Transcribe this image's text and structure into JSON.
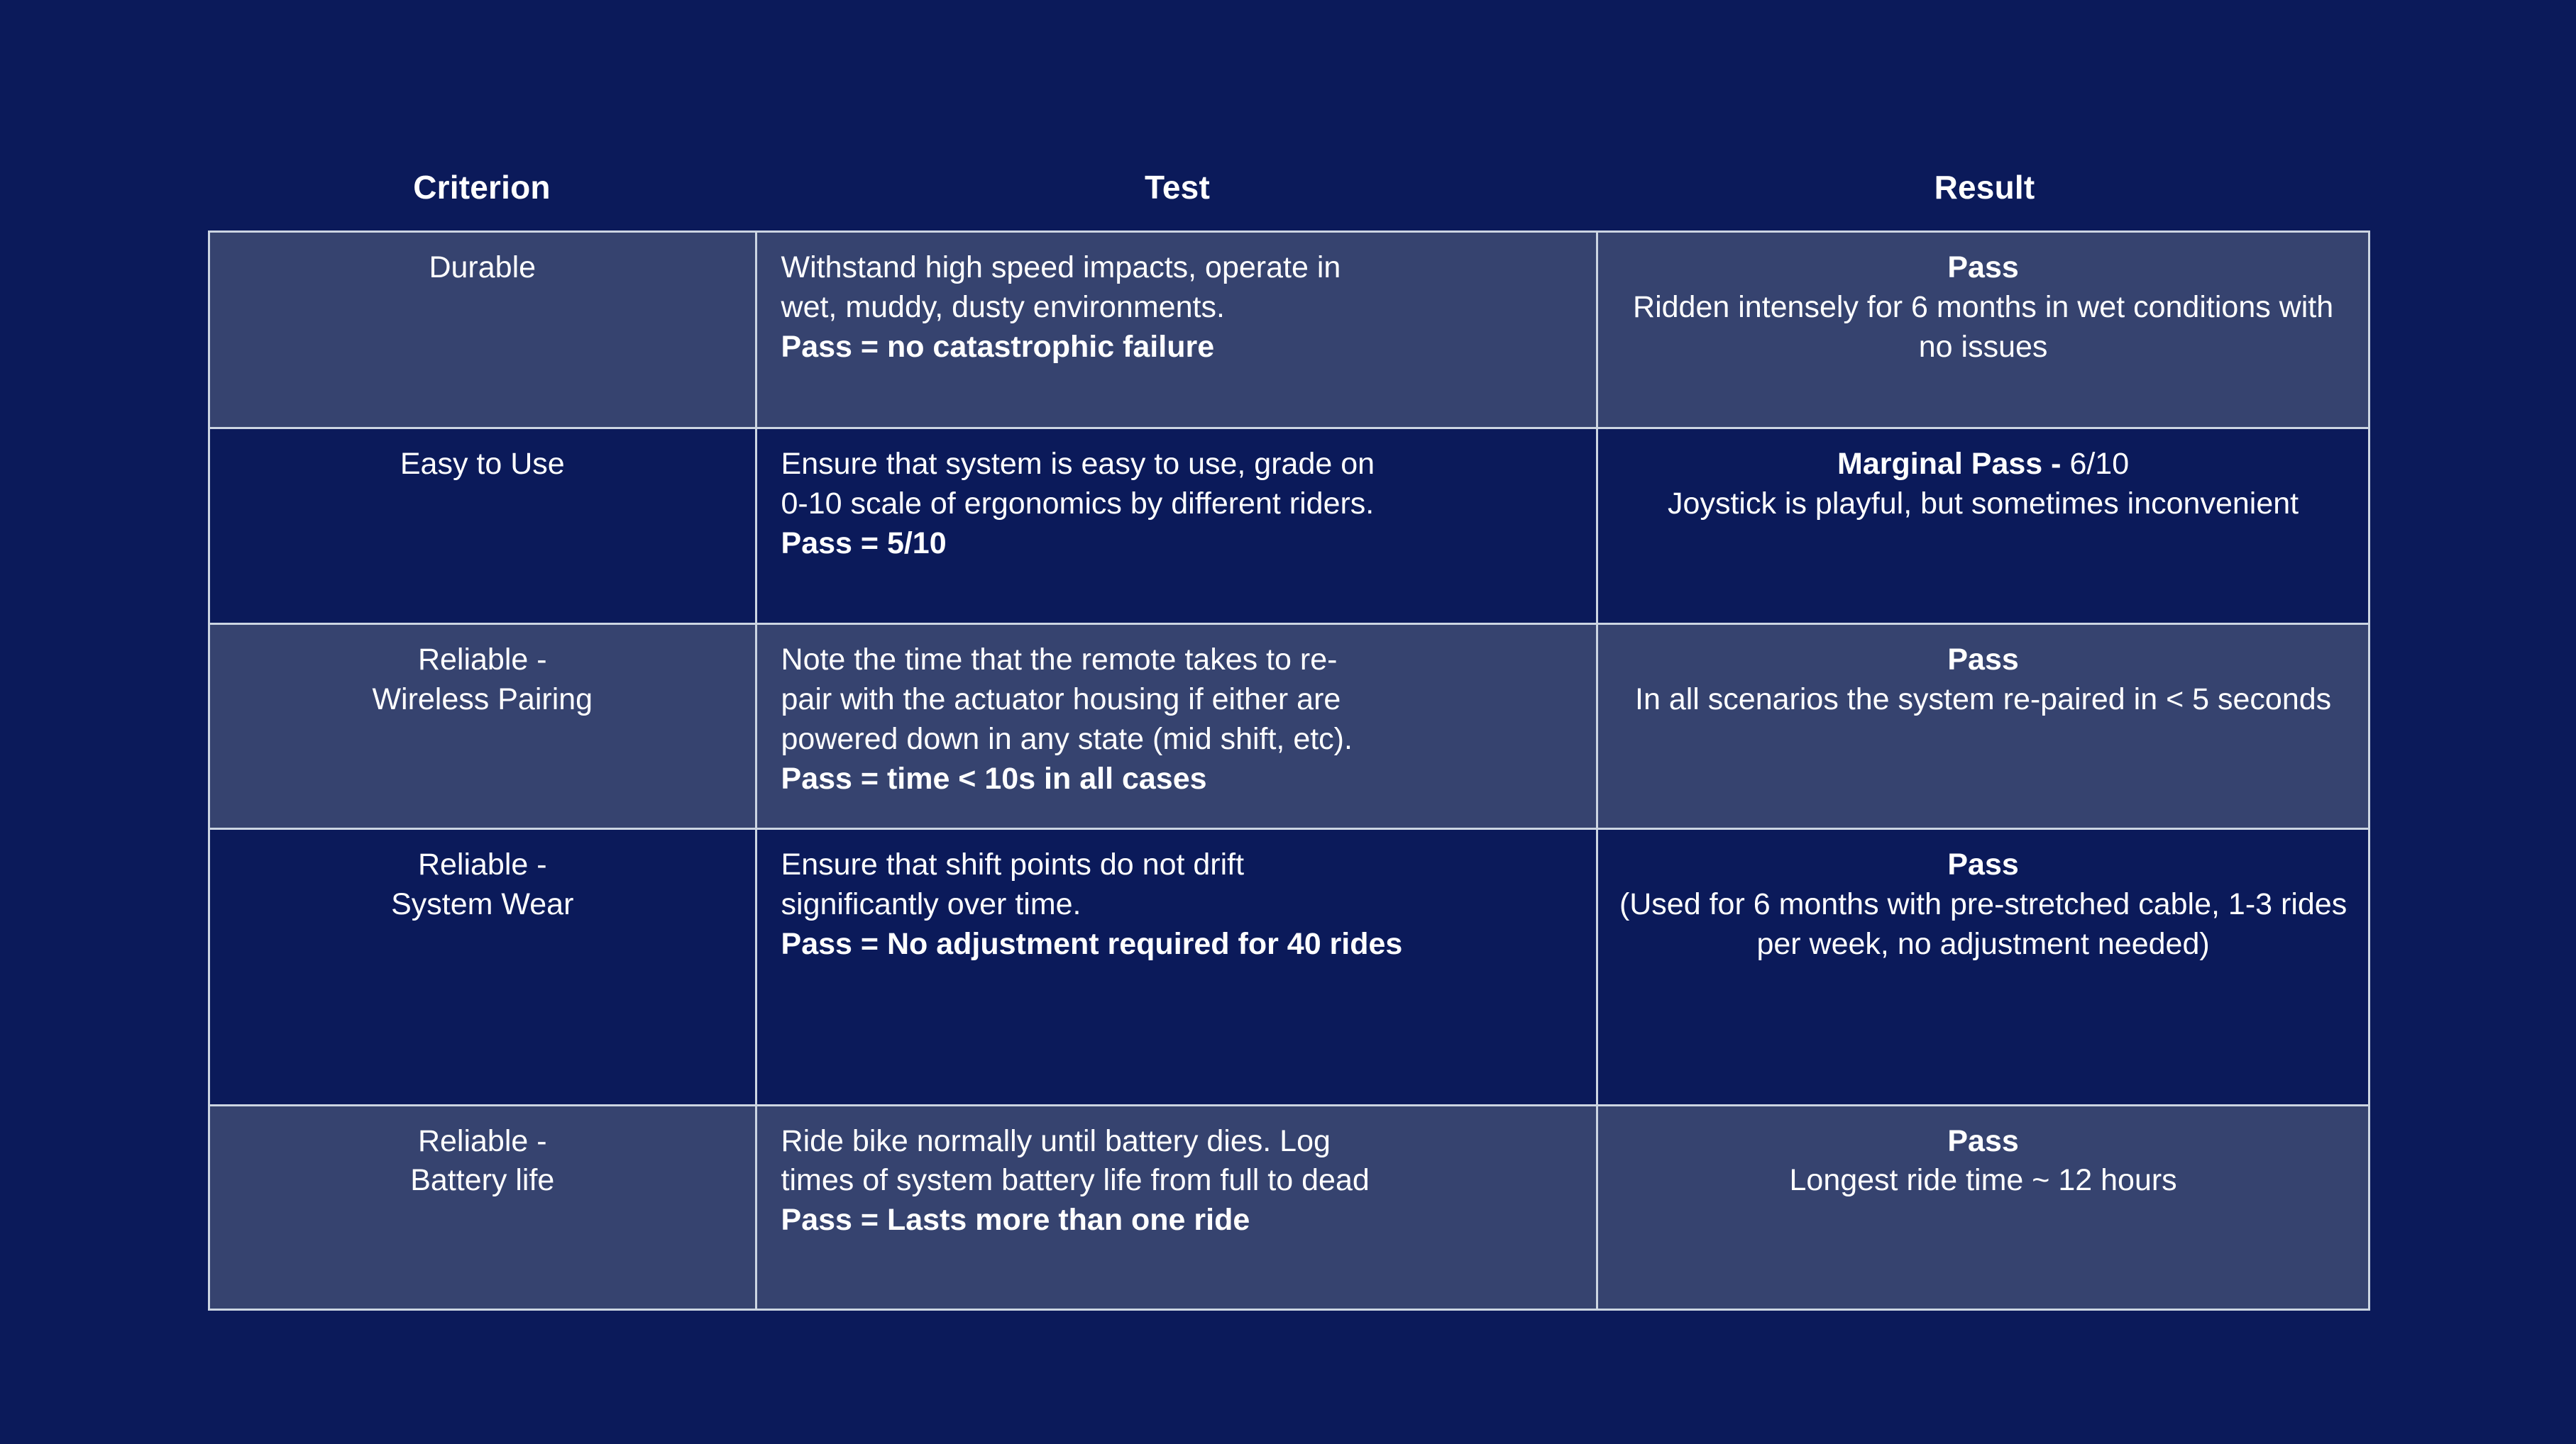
{
  "theme": {
    "page_background": "#0b1a5a",
    "row_light": "#36436f",
    "row_dark": "#0b1a5a",
    "border": "#ccd5e2",
    "text": "#ffffff"
  },
  "table": {
    "headers": {
      "criterion": "Criterion",
      "test": "Test",
      "result": "Result"
    },
    "rows": [
      {
        "criterion": "Durable",
        "test_line1": "Withstand high speed impacts, operate in",
        "test_line2": "wet, muddy, dusty environments.",
        "test_pass": "Pass = no catastrophic failure",
        "result_status": "Pass",
        "result_detail": "Ridden intensely for 6 months in wet conditions with no issues"
      },
      {
        "criterion": "Easy to Use",
        "test_line1": "Ensure that system is easy to use, grade on",
        "test_line2": "0-10 scale of ergonomics by different riders.",
        "test_pass": "Pass = 5/10",
        "result_status": "Marginal Pass - ",
        "result_status_suffix": "6/10",
        "result_detail": "Joystick is playful, but sometimes inconvenient"
      },
      {
        "criterion_line1": "Reliable -",
        "criterion_line2": "Wireless Pairing",
        "test_line1": "Note the time that the remote takes to re-",
        "test_line2": "pair with the actuator housing if either are",
        "test_line3": "powered down in any state (mid shift, etc).",
        "test_pass": "Pass = time < 10s in all cases",
        "result_status": "Pass",
        "result_detail": "In all scenarios the system re-paired in < 5 seconds"
      },
      {
        "criterion_line1": "Reliable -",
        "criterion_line2": "System Wear",
        "test_line1": "Ensure that shift points do not drift",
        "test_line2": "significantly over time.",
        "test_pass": "Pass = No adjustment required for 40 rides",
        "result_status": "Pass",
        "result_detail": "(Used for 6 months with pre-stretched cable, 1-3 rides per week, no adjustment needed)"
      },
      {
        "criterion_line1": "Reliable -",
        "criterion_line2": "Battery life",
        "test_line1": "Ride bike normally until battery dies. Log",
        "test_line2": "times of system battery life from full to dead",
        "test_pass": "Pass = Lasts more than one ride",
        "result_status": "Pass",
        "result_detail": "Longest ride time ~ 12 hours"
      }
    ]
  }
}
